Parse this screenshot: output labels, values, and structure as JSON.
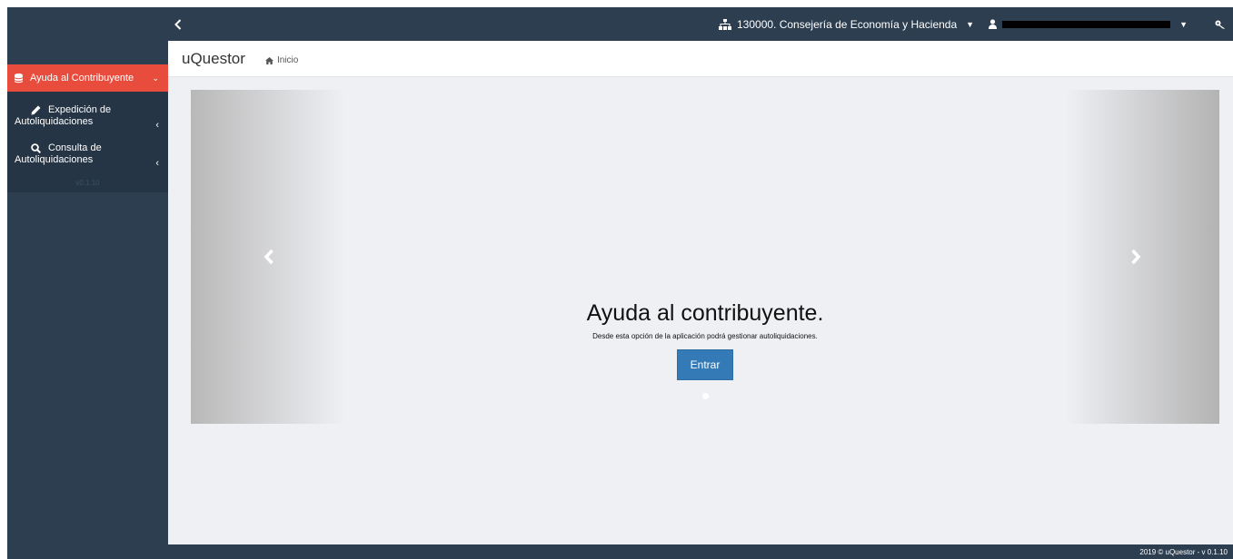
{
  "topbar": {
    "org_label": "130000. Consejería de Economía y Hacienda"
  },
  "app": {
    "title": "uQuestor"
  },
  "breadcrumb": {
    "home_label": "Inicio"
  },
  "sidebar": {
    "active_item": {
      "label": "Ayuda al Contribuyente"
    },
    "items": [
      {
        "line1": "Expedición de",
        "line2": "Autoliquidaciones"
      },
      {
        "line1": "Consulta de",
        "line2": "Autoliquidaciones"
      }
    ],
    "version": "v0.1.10"
  },
  "carousel": {
    "heading": "Ayuda al contribuyente.",
    "description": "Desde esta opción de la aplicación podrá gestionar autoliquidaciones.",
    "button_label": "Entrar"
  },
  "footer": {
    "text": "2019 © uQuestor - v 0.1.10"
  },
  "colors": {
    "navbar": "#2c3e50",
    "active_menu": "#e74c3c",
    "primary_button": "#337ab7",
    "content_bg": "#eff0f4"
  }
}
